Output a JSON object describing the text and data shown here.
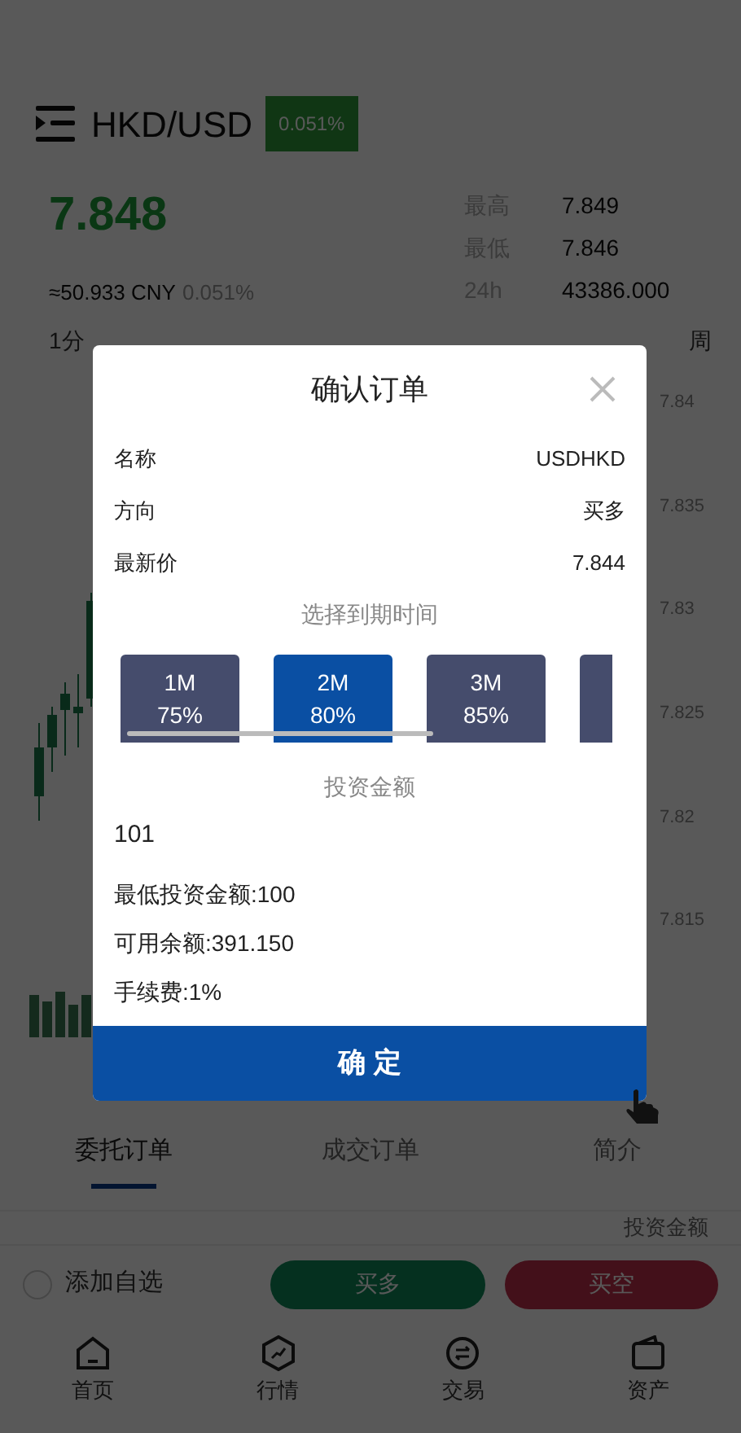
{
  "header": {
    "symbol": "HKD/USD",
    "change_badge": "0.051%"
  },
  "price": {
    "last": "7.848",
    "cny": "≈50.933 CNY",
    "change": "0.051%"
  },
  "stats": [
    {
      "label": "最高",
      "value": "7.849"
    },
    {
      "label": "最低",
      "value": "7.846"
    },
    {
      "label": "24h",
      "value": "43386.000"
    }
  ],
  "intervals": [
    "1分",
    "周"
  ],
  "chart": {
    "y_labels": [
      "7.84",
      "7.835",
      "7.83",
      "7.825",
      "7.82",
      "7.815"
    ]
  },
  "order_tabs": [
    {
      "label": "委托订单",
      "selected": true
    },
    {
      "label": "成交订单",
      "selected": false
    },
    {
      "label": "简介",
      "selected": false
    }
  ],
  "list_header": "投资金额",
  "watchlist": {
    "label": "添加自选",
    "checked": false
  },
  "actions": [
    {
      "label": "买多",
      "kind": "buy"
    },
    {
      "label": "买空",
      "kind": "sell"
    }
  ],
  "nav": [
    "首页",
    "行情",
    "交易",
    "资产"
  ],
  "dialog": {
    "title": "确认订单",
    "rows": [
      {
        "label": "名称",
        "value": "USDHKD"
      },
      {
        "label": "方向",
        "value": "买多"
      },
      {
        "label": "最新价",
        "value": "7.844"
      }
    ],
    "expiry_title": "选择到期时间",
    "options": [
      {
        "term": "1M",
        "rate": "75%",
        "selected": false
      },
      {
        "term": "2M",
        "rate": "80%",
        "selected": true
      },
      {
        "term": "3M",
        "rate": "85%",
        "selected": false
      }
    ],
    "amount_label": "投资金额",
    "amount_value": "101",
    "notes": [
      "最低投资金额:100",
      "可用余额:391.150",
      "手续费:1%"
    ],
    "confirm": "确 定"
  }
}
